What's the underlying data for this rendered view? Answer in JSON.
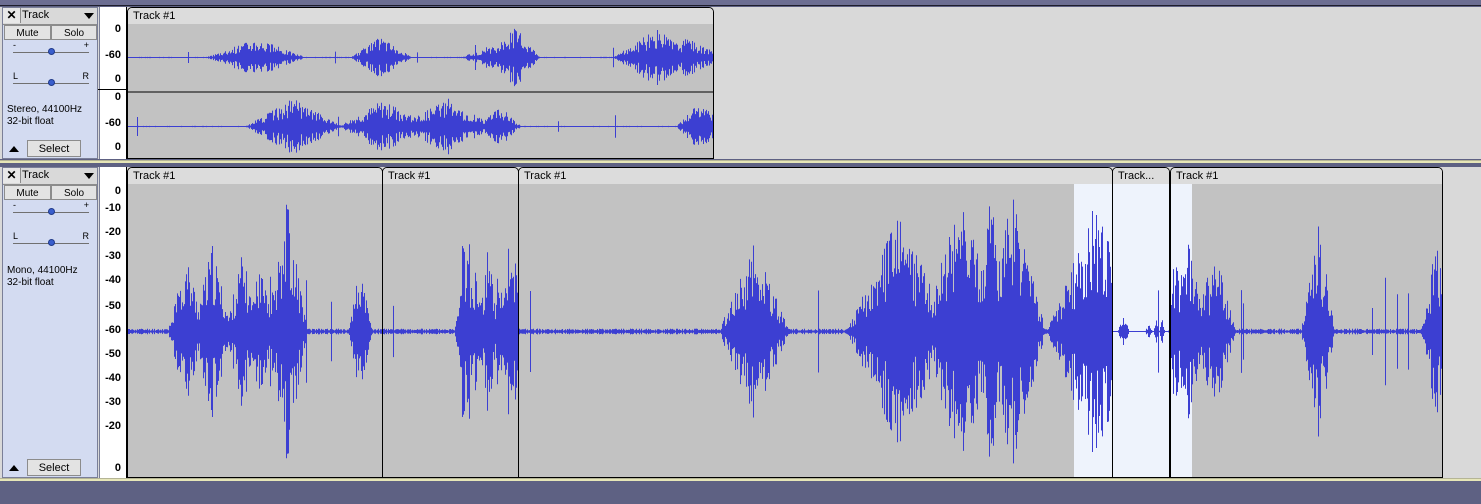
{
  "tracks": [
    {
      "name": "Track",
      "mute_label": "Mute",
      "solo_label": "Solo",
      "gain_minus": "-",
      "gain_plus": "+",
      "pan_left": "L",
      "pan_right": "R",
      "info_line1": "Stereo, 44100Hz",
      "info_line2": "32-bit float",
      "select_label": "Select",
      "close_glyph": "✕",
      "ruler_labels": [
        "0",
        "-60",
        "0",
        "0",
        "-60",
        "0"
      ],
      "clip_title": "Track #1"
    },
    {
      "name": "Track",
      "mute_label": "Mute",
      "solo_label": "Solo",
      "gain_minus": "-",
      "gain_plus": "+",
      "pan_left": "L",
      "pan_right": "R",
      "info_line1": "Mono, 44100Hz",
      "info_line2": "32-bit float",
      "select_label": "Select",
      "close_glyph": "✕",
      "ruler_labels": [
        "0",
        "-10",
        "-20",
        "-30",
        "-40",
        "-50",
        "-60",
        "-50",
        "-40",
        "-30",
        "-20",
        "0"
      ],
      "clips": [
        {
          "title": "Track #1"
        },
        {
          "title": "Track #1"
        },
        {
          "title": "Track #1"
        },
        {
          "title": "Track..."
        },
        {
          "title": "Track #1"
        }
      ]
    }
  ],
  "colors": {
    "waveform": "#3c3fd2",
    "clip_bg": "#c2c2c2",
    "selected_bg": "#eef3fc",
    "background": "#d9d9d9"
  }
}
